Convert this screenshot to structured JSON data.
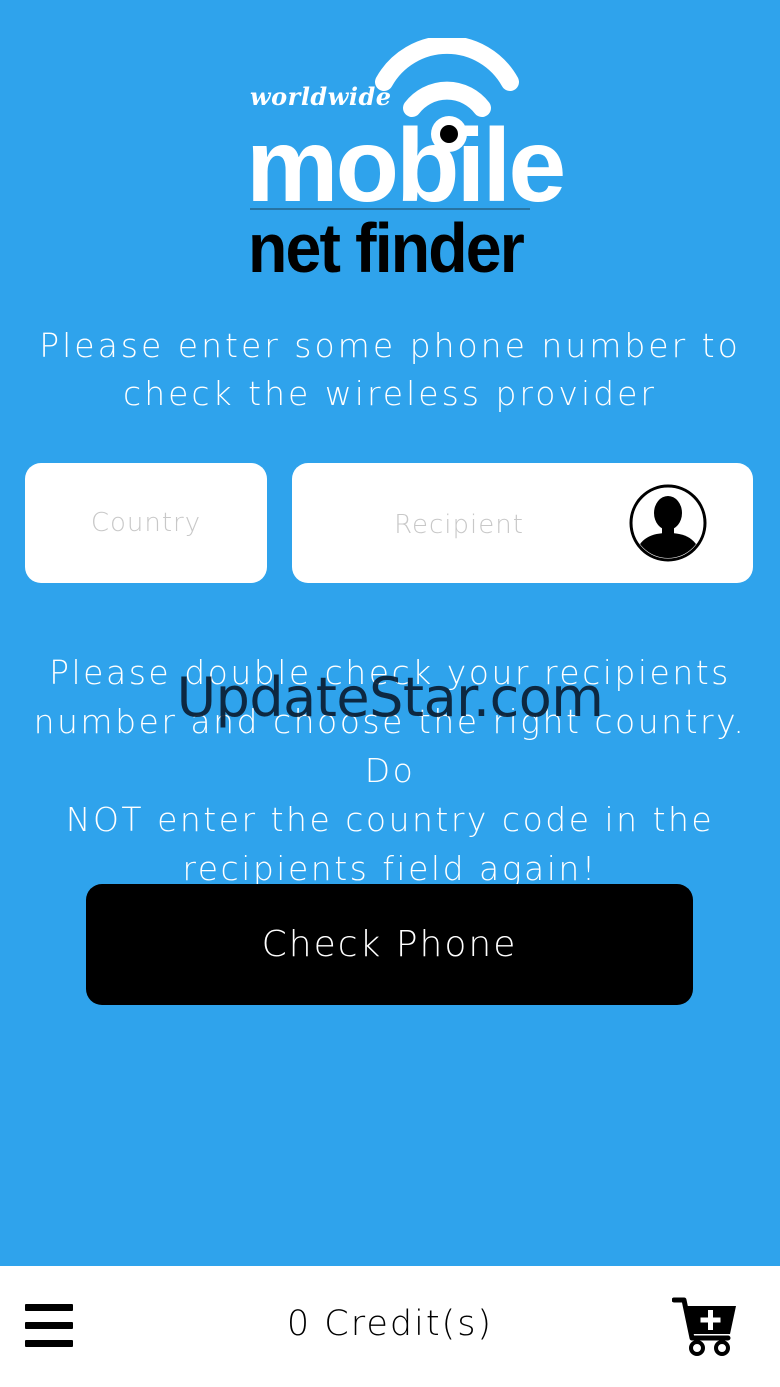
{
  "logo": {
    "worldwide": "worldwide",
    "mobile": "mobile",
    "net_finder": "net finder"
  },
  "intro": {
    "line1": "Please enter some phone number to",
    "line2": "check the wireless provider"
  },
  "form": {
    "country_placeholder": "Country",
    "recipient_placeholder": "Recipient",
    "contact_icon": "contact-person-icon"
  },
  "warning": {
    "line1": "Please double check your recipients",
    "line2": "number and choose the right country. Do",
    "line3": "NOT enter the country code in the",
    "line4": "recipients field again!"
  },
  "watermark": "UpdateStar.com",
  "check_button_label": "Check Phone",
  "bottom_bar": {
    "menu_icon": "hamburger-menu-icon",
    "credits": "0 Credit(s)",
    "cart_icon": "cart-add-icon"
  },
  "colors": {
    "background": "#2fa3ec",
    "button": "#000000",
    "bar": "#ffffff"
  }
}
